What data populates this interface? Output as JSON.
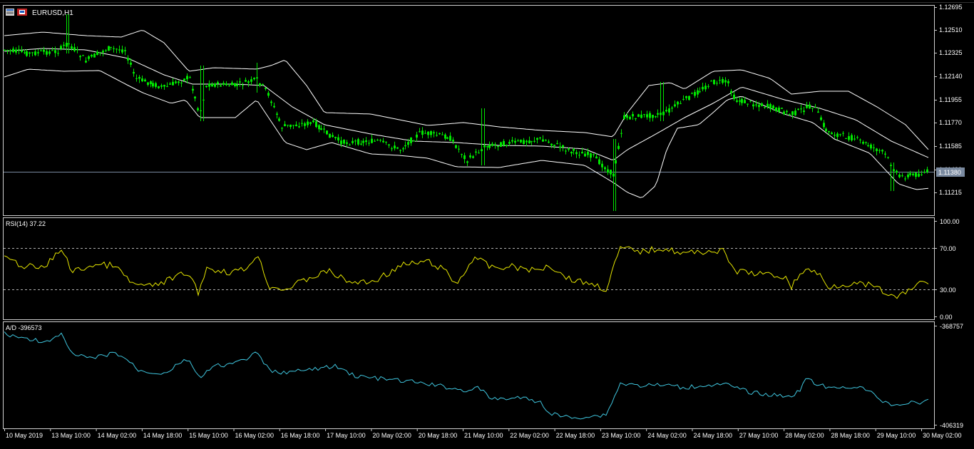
{
  "window": {
    "title": "EURUSD,H1",
    "icons": [
      "chart-window-icon",
      "restore-icon"
    ],
    "colors": {
      "background": "#000000",
      "frame": "#d0d0d0",
      "axis_text": "#ffffff",
      "candle": "#00e600",
      "bollinger": "#ffffff",
      "rsi_line": "#e6e600",
      "ad_line": "#3fc6df",
      "bid_line": "#7a8aa0",
      "bid_label_bg": "#7a8aa0"
    }
  },
  "main_panel": {
    "label": "EURUSD,H1",
    "price_ticks": [
      "1.12695",
      "1.12510",
      "1.12325",
      "1.12140",
      "1.11955",
      "1.11770",
      "1.11585",
      "1.11400",
      "1.11215"
    ],
    "current_price": "1.11380"
  },
  "rsi_panel": {
    "label": "RSI(14) 37.22",
    "ticks": [
      "100.00",
      "70.00",
      "30.00",
      "0.00"
    ],
    "levels": [
      70,
      30
    ]
  },
  "ad_panel": {
    "label": "A/D -396573",
    "ticks": [
      "-368757",
      "-406319"
    ]
  },
  "time_axis": {
    "labels": [
      "10 May 2019",
      "13 May 10:00",
      "14 May 02:00",
      "14 May 18:00",
      "15 May 10:00",
      "16 May 02:00",
      "16 May 18:00",
      "17 May 10:00",
      "20 May 02:00",
      "20 May 18:00",
      "21 May 10:00",
      "22 May 02:00",
      "22 May 18:00",
      "23 May 10:00",
      "24 May 02:00",
      "24 May 18:00",
      "27 May 10:00",
      "28 May 02:00",
      "28 May 18:00",
      "29 May 10:00",
      "30 May 02:00"
    ]
  },
  "chart_data": [
    {
      "type": "line",
      "name": "EURUSD,H1",
      "x_index": [
        0,
        25,
        50,
        75,
        100,
        125,
        150,
        175,
        200,
        225,
        250,
        275,
        300
      ],
      "close": [
        1.1232,
        1.123,
        1.121,
        1.1205,
        1.118,
        1.1175,
        1.116,
        1.1158,
        1.1155,
        1.1146,
        1.1195,
        1.1207,
        1.1138
      ],
      "ylim": [
        1.11215,
        1.12695
      ]
    },
    {
      "type": "line",
      "name": "RSI(14)",
      "last": 37.22,
      "ylim": [
        0,
        100
      ],
      "levels": [
        30,
        70
      ]
    },
    {
      "type": "line",
      "name": "A/D",
      "last": -396573,
      "ylim": [
        -406319,
        -368757
      ]
    }
  ]
}
